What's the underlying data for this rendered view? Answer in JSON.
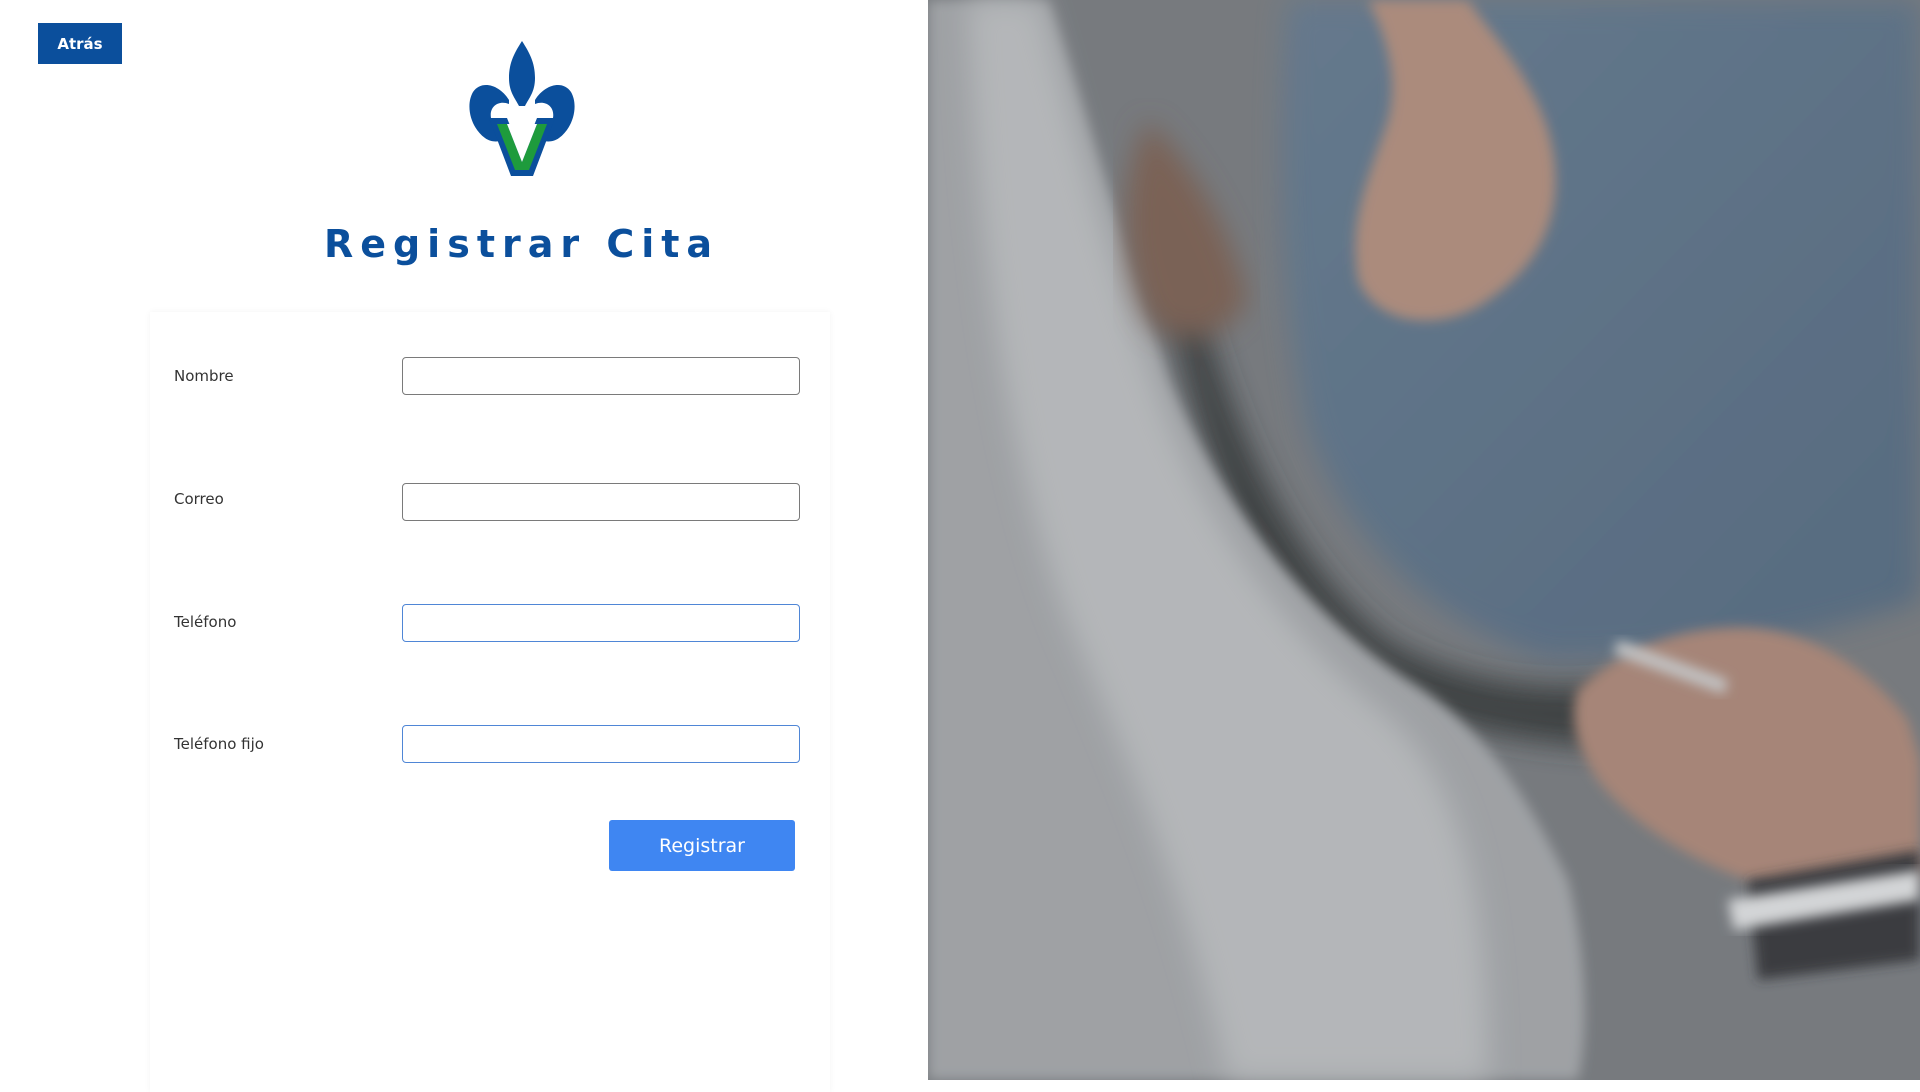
{
  "header": {
    "back_label": "Atrás"
  },
  "brand": {
    "logo_icon": "fleur-de-lis-v-logo",
    "primary_color": "#0b4f9c",
    "accent_color": "#1e9b3c"
  },
  "page": {
    "title": "Registrar Cita"
  },
  "form": {
    "fields": [
      {
        "label": "Nombre",
        "value": "",
        "placeholder": ""
      },
      {
        "label": "Correo",
        "value": "",
        "placeholder": ""
      },
      {
        "label": "Teléfono",
        "value": "",
        "placeholder": ""
      },
      {
        "label": "Teléfono fijo",
        "value": "",
        "placeholder": ""
      }
    ],
    "submit_label": "Registrar",
    "submit_color": "#3f86f2"
  },
  "hero_image": {
    "subject": "doctor-with-patient-photo"
  }
}
